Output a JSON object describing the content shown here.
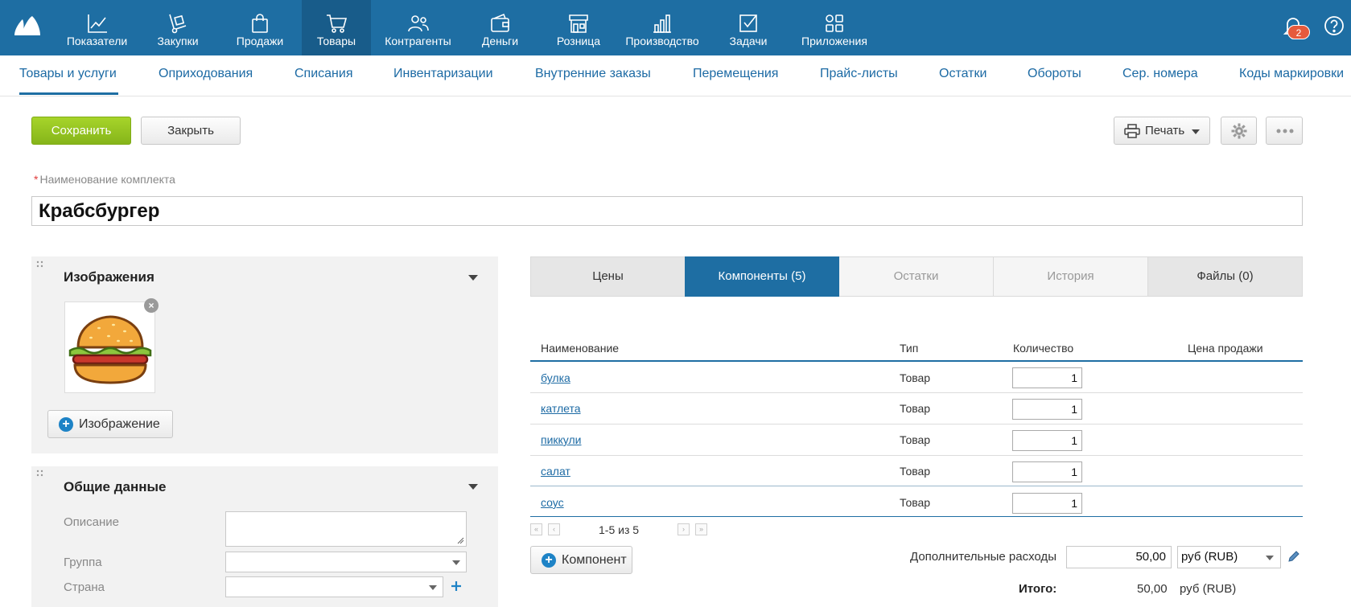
{
  "nav": {
    "items": [
      {
        "label": "Показатели",
        "icon": "chart-line-icon"
      },
      {
        "label": "Закупки",
        "icon": "hand-truck-icon"
      },
      {
        "label": "Продажи",
        "icon": "shopping-bag-icon"
      },
      {
        "label": "Товары",
        "icon": "cart-icon"
      },
      {
        "label": "Контрагенты",
        "icon": "people-icon"
      },
      {
        "label": "Деньги",
        "icon": "wallet-icon"
      },
      {
        "label": "Розница",
        "icon": "store-icon"
      },
      {
        "label": "Производство",
        "icon": "factory-icon"
      },
      {
        "label": "Задачи",
        "icon": "checkbox-icon"
      },
      {
        "label": "Приложения",
        "icon": "apps-icon"
      }
    ],
    "active": "Товары",
    "notification_count": "2"
  },
  "subnav": {
    "items": [
      "Товары и услуги",
      "Оприходования",
      "Списания",
      "Инвентаризации",
      "Внутренние заказы",
      "Перемещения",
      "Прайс-листы",
      "Остатки",
      "Обороты",
      "Сер. номера",
      "Коды маркировки"
    ]
  },
  "toolbar": {
    "save_label": "Сохранить",
    "close_label": "Закрыть",
    "print_label": "Печать"
  },
  "form": {
    "name_label": "Наименование комплекта",
    "name_value": "Крабсбургер"
  },
  "images_panel": {
    "title": "Изображения",
    "add_label": "Изображение"
  },
  "general_panel": {
    "title": "Общие данные",
    "description_label": "Описание",
    "group_label": "Группа",
    "country_label": "Страна"
  },
  "tabs": [
    {
      "label": "Цены"
    },
    {
      "label": "Компоненты (5)"
    },
    {
      "label": "Остатки"
    },
    {
      "label": "История"
    },
    {
      "label": "Файлы (0)"
    }
  ],
  "components": {
    "headers": [
      "Наименование",
      "Тип",
      "Количество",
      "Цена продажи"
    ],
    "rows": [
      {
        "name": "булка",
        "type": "Товар",
        "qty": "1"
      },
      {
        "name": "катлета",
        "type": "Товар",
        "qty": "1"
      },
      {
        "name": "пиккули",
        "type": "Товар",
        "qty": "1"
      },
      {
        "name": "салат",
        "type": "Товар",
        "qty": "1"
      },
      {
        "name": "соус",
        "type": "Товар",
        "qty": "1"
      }
    ],
    "pagination": "1-5 из 5",
    "add_label": "Компонент"
  },
  "totals": {
    "extra_label": "Дополнительные расходы",
    "extra_value": "50,00",
    "currency": "руб (RUB)",
    "total_label": "Итого:",
    "total_value": "50,00",
    "total_currency": "руб (RUB)"
  },
  "colors": {
    "primary": "#1e6ea3",
    "save_green": "#92c11f",
    "link": "#1c6aa4"
  }
}
